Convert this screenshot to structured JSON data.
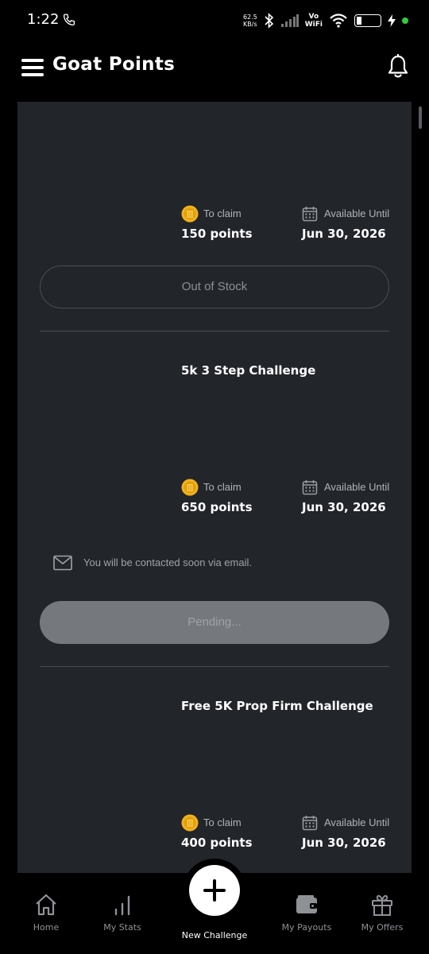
{
  "status_bar": {
    "time": "1:22",
    "net_speed_value": "62.5",
    "net_speed_unit": "KB/s",
    "vowifi_top": "Vo",
    "vowifi_bottom": "WiFi",
    "battery_level": "16"
  },
  "header": {
    "title": "Goat Points"
  },
  "cards": [
    {
      "title": "",
      "claim_label": "To claim",
      "points": "150 points",
      "available_label": "Available Until",
      "date": "Jun 30, 2026",
      "button_label": "Out of Stock"
    },
    {
      "title": "5k 3 Step Challenge",
      "claim_label": "To claim",
      "points": "650 points",
      "available_label": "Available Until",
      "date": "Jun 30, 2026",
      "notice": "You will be contacted soon via email.",
      "button_label": "Pending..."
    },
    {
      "title": "Free 5K Prop Firm Challenge",
      "claim_label": "To claim",
      "points": "400 points",
      "available_label": "Available Until",
      "date": "Jun 30, 2026"
    }
  ],
  "bottom_nav": {
    "items": [
      {
        "label": "Home",
        "icon": "home-icon"
      },
      {
        "label": "My Stats",
        "icon": "stats-icon"
      },
      {
        "label": "New Challenge",
        "icon": "plus-icon"
      },
      {
        "label": "My Payouts",
        "icon": "wallet-icon"
      },
      {
        "label": "My Offers",
        "icon": "gift-icon"
      }
    ]
  },
  "colors": {
    "background": "#000000",
    "panel": "#22252a",
    "coin": "#f2b21b",
    "muted_text": "#b0b3b8",
    "pending_button": "#75787c"
  }
}
